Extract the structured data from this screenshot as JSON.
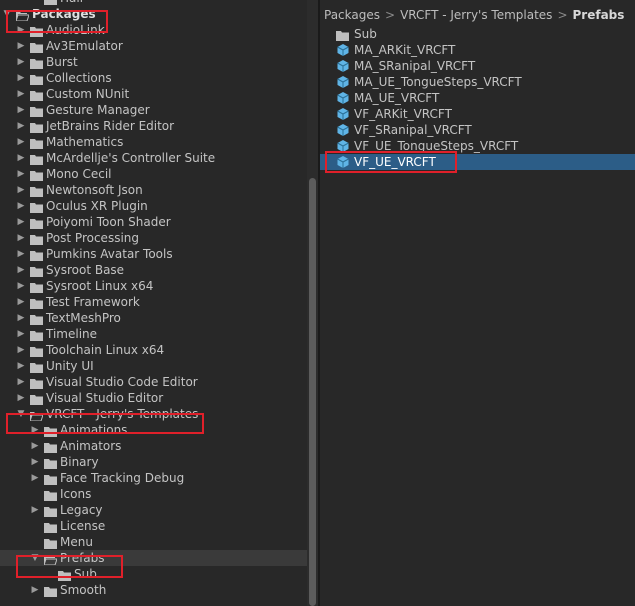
{
  "tree": {
    "items": [
      {
        "label": "Hair",
        "depth": 2,
        "arrow": "",
        "selected": false,
        "bold": false
      },
      {
        "label": "Packages",
        "depth": 0,
        "arrow": "down",
        "selected": false,
        "bold": true
      },
      {
        "label": "AudioLink",
        "depth": 1,
        "arrow": "right",
        "selected": false,
        "bold": false
      },
      {
        "label": "Av3Emulator",
        "depth": 1,
        "arrow": "right",
        "selected": false,
        "bold": false
      },
      {
        "label": "Burst",
        "depth": 1,
        "arrow": "right",
        "selected": false,
        "bold": false
      },
      {
        "label": "Collections",
        "depth": 1,
        "arrow": "right",
        "selected": false,
        "bold": false
      },
      {
        "label": "Custom NUnit",
        "depth": 1,
        "arrow": "right",
        "selected": false,
        "bold": false
      },
      {
        "label": "Gesture Manager",
        "depth": 1,
        "arrow": "right",
        "selected": false,
        "bold": false
      },
      {
        "label": "JetBrains Rider Editor",
        "depth": 1,
        "arrow": "right",
        "selected": false,
        "bold": false
      },
      {
        "label": "Mathematics",
        "depth": 1,
        "arrow": "right",
        "selected": false,
        "bold": false
      },
      {
        "label": "McArdellje's Controller Suite",
        "depth": 1,
        "arrow": "right",
        "selected": false,
        "bold": false
      },
      {
        "label": "Mono Cecil",
        "depth": 1,
        "arrow": "right",
        "selected": false,
        "bold": false
      },
      {
        "label": "Newtonsoft Json",
        "depth": 1,
        "arrow": "right",
        "selected": false,
        "bold": false
      },
      {
        "label": "Oculus XR Plugin",
        "depth": 1,
        "arrow": "right",
        "selected": false,
        "bold": false
      },
      {
        "label": "Poiyomi Toon Shader",
        "depth": 1,
        "arrow": "right",
        "selected": false,
        "bold": false
      },
      {
        "label": "Post Processing",
        "depth": 1,
        "arrow": "right",
        "selected": false,
        "bold": false
      },
      {
        "label": "Pumkins Avatar Tools",
        "depth": 1,
        "arrow": "right",
        "selected": false,
        "bold": false
      },
      {
        "label": "Sysroot Base",
        "depth": 1,
        "arrow": "right",
        "selected": false,
        "bold": false
      },
      {
        "label": "Sysroot Linux x64",
        "depth": 1,
        "arrow": "right",
        "selected": false,
        "bold": false
      },
      {
        "label": "Test Framework",
        "depth": 1,
        "arrow": "right",
        "selected": false,
        "bold": false
      },
      {
        "label": "TextMeshPro",
        "depth": 1,
        "arrow": "right",
        "selected": false,
        "bold": false
      },
      {
        "label": "Timeline",
        "depth": 1,
        "arrow": "right",
        "selected": false,
        "bold": false
      },
      {
        "label": "Toolchain Linux x64",
        "depth": 1,
        "arrow": "right",
        "selected": false,
        "bold": false
      },
      {
        "label": "Unity UI",
        "depth": 1,
        "arrow": "right",
        "selected": false,
        "bold": false
      },
      {
        "label": "Visual Studio Code Editor",
        "depth": 1,
        "arrow": "right",
        "selected": false,
        "bold": false
      },
      {
        "label": "Visual Studio Editor",
        "depth": 1,
        "arrow": "right",
        "selected": false,
        "bold": false
      },
      {
        "label": "VRCFT - Jerry's Templates",
        "depth": 1,
        "arrow": "down",
        "selected": false,
        "bold": false
      },
      {
        "label": "Animations",
        "depth": 2,
        "arrow": "right",
        "selected": false,
        "bold": false
      },
      {
        "label": "Animators",
        "depth": 2,
        "arrow": "right",
        "selected": false,
        "bold": false
      },
      {
        "label": "Binary",
        "depth": 2,
        "arrow": "right",
        "selected": false,
        "bold": false
      },
      {
        "label": "Face Tracking Debug",
        "depth": 2,
        "arrow": "right",
        "selected": false,
        "bold": false
      },
      {
        "label": "Icons",
        "depth": 2,
        "arrow": "",
        "selected": false,
        "bold": false
      },
      {
        "label": "Legacy",
        "depth": 2,
        "arrow": "right",
        "selected": false,
        "bold": false
      },
      {
        "label": "License",
        "depth": 2,
        "arrow": "",
        "selected": false,
        "bold": false
      },
      {
        "label": "Menu",
        "depth": 2,
        "arrow": "",
        "selected": false,
        "bold": false
      },
      {
        "label": "Prefabs",
        "depth": 2,
        "arrow": "down",
        "selected": true,
        "bold": false
      },
      {
        "label": "Sub",
        "depth": 3,
        "arrow": "",
        "selected": false,
        "bold": false
      },
      {
        "label": "Smooth",
        "depth": 2,
        "arrow": "right",
        "selected": false,
        "bold": false
      }
    ]
  },
  "breadcrumb": {
    "parts": [
      "Packages",
      "VRCFT - Jerry's Templates"
    ],
    "current": "Prefabs",
    "separator": ">"
  },
  "files": [
    {
      "label": "Sub",
      "kind": "folder",
      "selected": false
    },
    {
      "label": "MA_ARKit_VRCFT",
      "kind": "prefab",
      "selected": false
    },
    {
      "label": "MA_SRanipal_VRCFT",
      "kind": "prefab",
      "selected": false
    },
    {
      "label": "MA_UE_TongueSteps_VRCFT",
      "kind": "prefab",
      "selected": false
    },
    {
      "label": "MA_UE_VRCFT",
      "kind": "prefab",
      "selected": false
    },
    {
      "label": "VF_ARKit_VRCFT",
      "kind": "prefab",
      "selected": false
    },
    {
      "label": "VF_SRanipal_VRCFT",
      "kind": "prefab",
      "selected": false
    },
    {
      "label": "VF_UE_TongueSteps_VRCFT",
      "kind": "prefab",
      "selected": false
    },
    {
      "label": "VF_UE_VRCFT",
      "kind": "prefab",
      "selected": true
    }
  ],
  "colors": {
    "background": "#282828",
    "selection": "#2c5d87",
    "folder": "#bfbfbf",
    "prefab": "#5fb4e6",
    "highlight": "#e0202a"
  }
}
